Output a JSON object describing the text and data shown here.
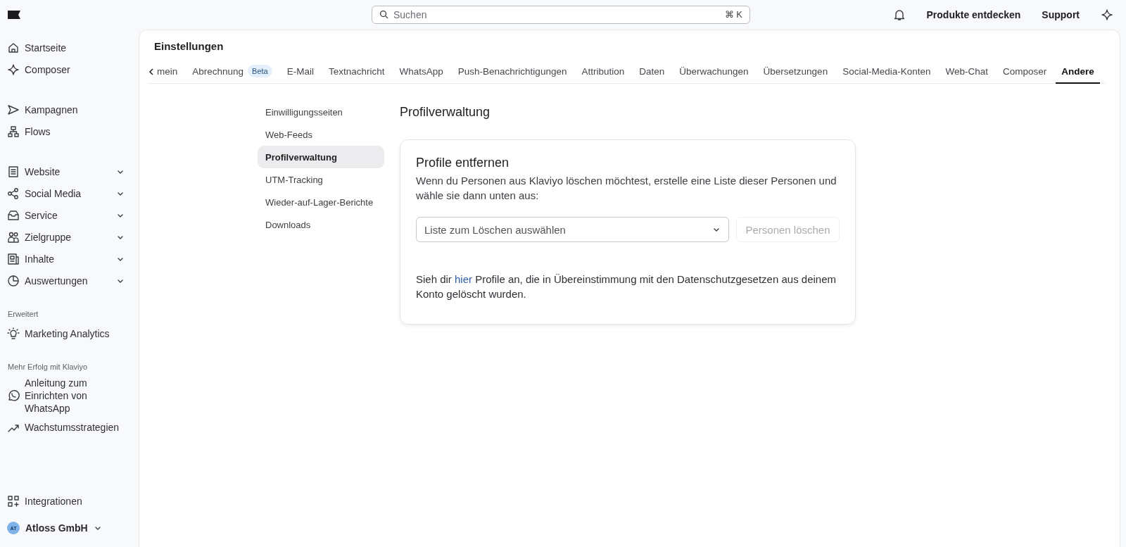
{
  "topbar": {
    "search": {
      "placeholder": "Suchen",
      "shortcut": "⌘ K"
    },
    "links": [
      "Produkte entdecken",
      "Support"
    ]
  },
  "sidebar": {
    "groups": [
      {
        "items": [
          {
            "label": "Startseite",
            "has_submenu": false
          },
          {
            "label": "Composer",
            "has_submenu": false
          }
        ]
      },
      {
        "items": [
          {
            "label": "Kampagnen",
            "has_submenu": false
          },
          {
            "label": "Flows",
            "has_submenu": false
          }
        ]
      },
      {
        "items": [
          {
            "label": "Website",
            "has_submenu": true
          },
          {
            "label": "Social Media",
            "has_submenu": true
          },
          {
            "label": "Service",
            "has_submenu": true
          },
          {
            "label": "Zielgruppe",
            "has_submenu": true
          },
          {
            "label": "Inhalte",
            "has_submenu": true
          },
          {
            "label": "Auswertungen",
            "has_submenu": true
          }
        ]
      },
      {
        "heading": "Erweitert",
        "items": [
          {
            "label": "Marketing Analytics",
            "has_submenu": false
          }
        ]
      },
      {
        "heading": "Mehr Erfolg mit Klaviyo",
        "items": [
          {
            "label": "Anleitung zum Einrichten von WhatsApp",
            "has_submenu": false
          },
          {
            "label": "Wachstumsstrategien",
            "has_submenu": false
          }
        ]
      }
    ],
    "footer": {
      "items": [
        {
          "label": "Integrationen",
          "has_submenu": false
        }
      ]
    },
    "account": {
      "initials": "AT",
      "name": "Atloss GmbH"
    }
  },
  "settings": {
    "title": "Einstellungen",
    "tabs": [
      {
        "label": "mein",
        "selected": false
      },
      {
        "label": "Abrechnung",
        "badge": "Beta",
        "selected": false
      },
      {
        "label": "E-Mail",
        "selected": false
      },
      {
        "label": "Textnachricht",
        "selected": false
      },
      {
        "label": "WhatsApp",
        "selected": false
      },
      {
        "label": "Push-Benachrichtigungen",
        "selected": false
      },
      {
        "label": "Attribution",
        "selected": false
      },
      {
        "label": "Daten",
        "selected": false
      },
      {
        "label": "Überwachungen",
        "selected": false
      },
      {
        "label": "Übersetzungen",
        "selected": false
      },
      {
        "label": "Social-Media-Konten",
        "selected": false
      },
      {
        "label": "Web-Chat",
        "selected": false
      },
      {
        "label": "Composer",
        "selected": false
      },
      {
        "label": "Andere",
        "selected": true
      }
    ],
    "subnav": [
      {
        "label": "Einwilligungsseiten",
        "selected": false
      },
      {
        "label": "Web-Feeds",
        "selected": false
      },
      {
        "label": "Profilverwaltung",
        "selected": true
      },
      {
        "label": "UTM-Tracking",
        "selected": false
      },
      {
        "label": "Wieder-auf-Lager-Berichte",
        "selected": false
      },
      {
        "label": "Downloads",
        "selected": false
      }
    ],
    "section_title": "Profilverwaltung",
    "card": {
      "title": "Profile entfernen",
      "description": "Wenn du Personen aus Klaviyo löschen möchtest, erstelle eine Liste dieser Personen und wähle sie dann unten aus:",
      "select": {
        "placeholder": "Liste zum Löschen auswählen"
      },
      "button": {
        "label": "Personen löschen",
        "disabled": true
      },
      "note": {
        "before": "Sieh dir ",
        "link": "hier",
        "after": " Profile an, die in Übereinstimmung mit den Datenschutzgesetzen aus deinem Konto gelöscht wurden."
      }
    }
  }
}
